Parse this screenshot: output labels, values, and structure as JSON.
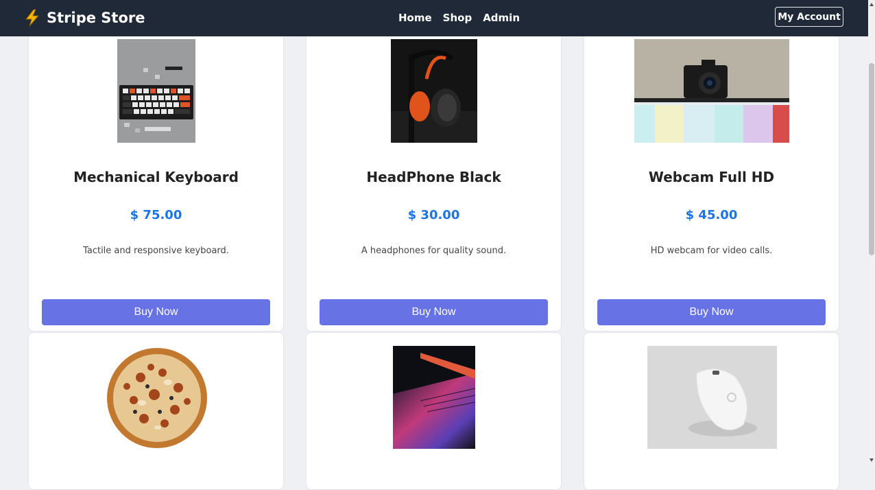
{
  "navbar": {
    "brand": "Stripe Store",
    "brand_icon": "lightning-bolt-icon",
    "links": [
      "Home",
      "Shop",
      "Admin"
    ],
    "account_button": "My Account"
  },
  "products": [
    {
      "name": "Mechanical Keyboard",
      "price": "$ 75.00",
      "description": "Tactile and responsive keyboard.",
      "button": "Buy Now"
    },
    {
      "name": "HeadPhone Black",
      "price": "$ 30.00",
      "description": "A headphones for quality sound.",
      "button": "Buy Now"
    },
    {
      "name": "Webcam Full HD",
      "price": "$ 45.00",
      "description": "HD webcam for video calls.",
      "button": "Buy Now"
    }
  ],
  "colors": {
    "navbar_bg": "#1f2937",
    "price": "#1a73e8",
    "button_bg": "#6772e5",
    "page_bg": "#eef0f3"
  }
}
